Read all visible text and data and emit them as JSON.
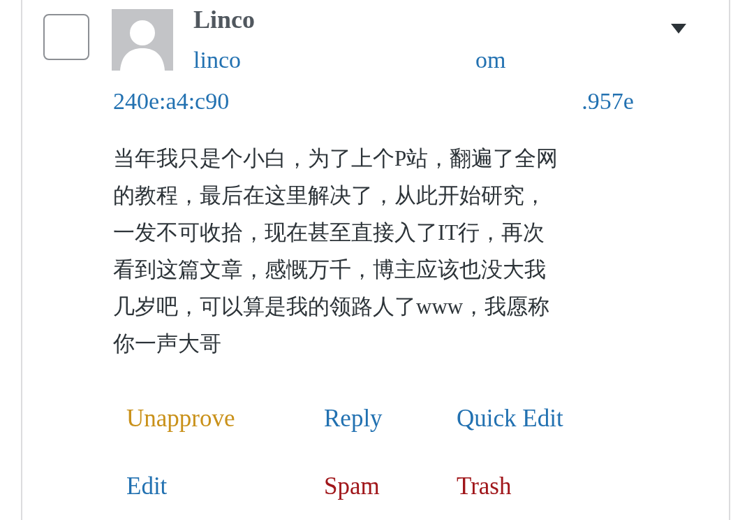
{
  "comment": {
    "selected": false,
    "author": "Linco",
    "email_start": "linco",
    "email_end": "om",
    "ip_start": "240e:a4:c90",
    "ip_end": ".957e",
    "text_lines": [
      "当年我只是个小白，为了上个P站，翻遍了全网",
      "的教程，最后在这里解决了，从此开始研究，",
      "一发不可收拾，现在甚至直接入了IT行，再次",
      "看到这篇文章，感慨万千，博主应该也没大我",
      "几岁吧，可以算是我的领路人了www，我愿称",
      "你一声大哥"
    ],
    "actions": [
      {
        "label": "Unapprove",
        "kind": "approve"
      },
      {
        "label": "Reply",
        "kind": "normal"
      },
      {
        "label": "Quick Edit",
        "kind": "normal"
      },
      {
        "label": "Edit",
        "kind": "normal"
      },
      {
        "label": "Spam",
        "kind": "danger"
      },
      {
        "label": "Trash",
        "kind": "danger"
      }
    ]
  }
}
